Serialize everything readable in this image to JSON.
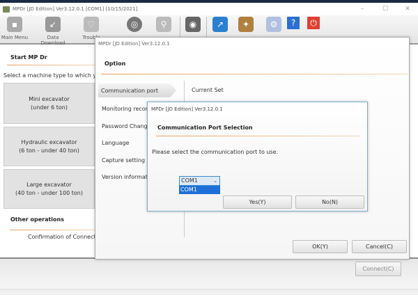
{
  "window": {
    "title": "MPDr [JD Edition] Ver3.12.0.1 [COM1] [10/15/2021]"
  },
  "toolbar": {
    "items": [
      {
        "label": "Main Menu",
        "icon": "main-menu-icon"
      },
      {
        "label": "Data Download",
        "icon": "download-icon"
      },
      {
        "label": "Trouble",
        "icon": "stethoscope-icon"
      },
      {
        "label": "",
        "icon": "gauge-icon"
      },
      {
        "label": "",
        "icon": "tools-icon"
      },
      {
        "label": "",
        "icon": "camera-icon"
      },
      {
        "label": "",
        "icon": "upload-icon"
      },
      {
        "label": "",
        "icon": "mp-info-icon"
      },
      {
        "label": "",
        "icon": "gear-icon"
      },
      {
        "label": "",
        "icon": "help-icon"
      },
      {
        "label": "",
        "icon": "power-icon"
      }
    ]
  },
  "start": {
    "title": "Start MP Dr",
    "prompt": "Select a machine type to which you w",
    "machines": [
      {
        "name": "Mini excavator",
        "range": "(under 6 ton)"
      },
      {
        "name": "Hydraulic excavator",
        "range": "(6 ton - under 40 ton)"
      },
      {
        "name": "Large excavator",
        "range": "(40 ton - under 100 ton)"
      }
    ],
    "other_title": "Other operations",
    "confirmation": "Confirmation of Connectio",
    "connect": "Connect(C)"
  },
  "option": {
    "title": "MPDr [JD Edition] Ver3.12.0.1",
    "heading": "Option",
    "menu": [
      "Communication port",
      "Monitoring record",
      "Password Change",
      "Language",
      "Capture setting",
      "Version information"
    ],
    "current_set": "Current Set",
    "ok": "OK(Y)",
    "cancel": "Cancel(C)"
  },
  "port": {
    "title": "MPDr [JD Edition] Ver3.12.0.1",
    "heading": "Communication Port Selection",
    "message": "Please select the communication port to use.",
    "selected": "COM1",
    "options": [
      "COM1"
    ],
    "yes": "Yes(Y)",
    "no": "No(N)"
  }
}
